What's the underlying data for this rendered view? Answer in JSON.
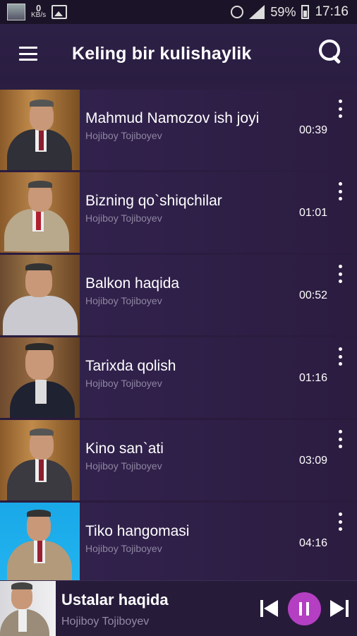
{
  "status_bar": {
    "kbs_value": "0",
    "kbs_unit": "KB/s",
    "battery": "59%",
    "time": "17:16"
  },
  "header": {
    "title": "Keling bir kulishaylik",
    "menu_icon": "menu-icon",
    "search_icon": "search-icon"
  },
  "songs": [
    {
      "title": "Mahmud Namozov ish joyi",
      "artist": "Hojiboy Tojiboyev",
      "duration": "00:39"
    },
    {
      "title": "Bizning qo`shiqchilar",
      "artist": "Hojiboy Tojiboyev",
      "duration": "01:01"
    },
    {
      "title": "Balkon haqida",
      "artist": "Hojiboy Tojiboyev",
      "duration": "00:52"
    },
    {
      "title": "Tarixda qolish",
      "artist": "Hojiboy Tojiboyev",
      "duration": "01:16"
    },
    {
      "title": "Kino san`ati",
      "artist": "Hojiboy Tojiboyev",
      "duration": "03:09"
    },
    {
      "title": "Tiko hangomasi",
      "artist": "Hojiboy Tojiboyev",
      "duration": "04:16"
    }
  ],
  "now_playing": {
    "title": "Ustalar haqida",
    "artist": "Hojiboy Tojiboyev"
  },
  "colors": {
    "accent": "#b43fc2",
    "background": "#2b1d41",
    "secondary_text": "#8f85a2"
  }
}
